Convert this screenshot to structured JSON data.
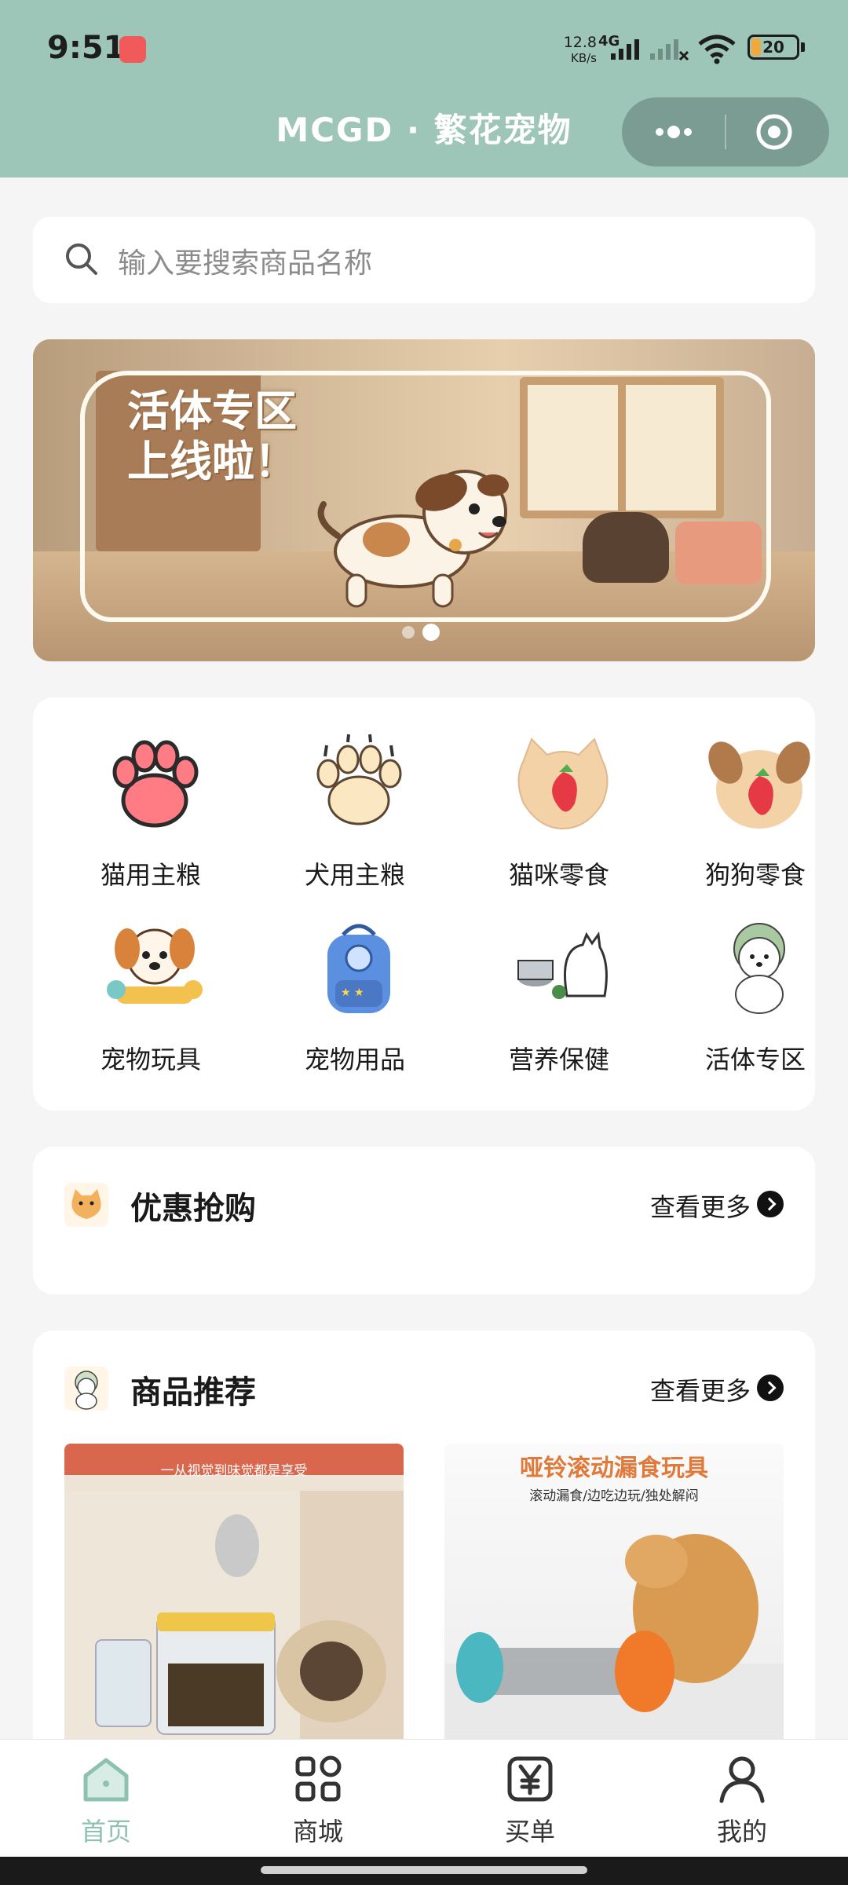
{
  "status_bar": {
    "time": "9:51",
    "network_speed_value": "12.8",
    "network_speed_unit": "KB/s",
    "network_type": "4G",
    "battery_level": "20"
  },
  "header": {
    "title": "MCGD · 繁花宠物"
  },
  "search": {
    "placeholder": "输入要搜索商品名称"
  },
  "banner": {
    "headline_line1": "活体专区",
    "headline_line2": "上线啦！",
    "slide_count": 2,
    "active_slide": 2
  },
  "categories": [
    {
      "label": "猫用主粮",
      "icon": "cat-paw-icon"
    },
    {
      "label": "犬用主粮",
      "icon": "dog-paw-icon"
    },
    {
      "label": "猫咪零食",
      "icon": "cat-cookie-icon"
    },
    {
      "label": "狗狗零食",
      "icon": "dog-cookie-icon"
    },
    {
      "label": "宠物玩具",
      "icon": "puppy-toy-icon"
    },
    {
      "label": "宠物用品",
      "icon": "backpack-icon"
    },
    {
      "label": "营养保健",
      "icon": "cat-bowl-icon"
    },
    {
      "label": "活体专区",
      "icon": "puppy-icon"
    }
  ],
  "deals": {
    "title": "优惠抢购",
    "more": "查看更多"
  },
  "recommend": {
    "title": "商品推荐",
    "more": "查看更多",
    "products": [
      {
        "title": "",
        "subtitle": "一从视觉到味觉都是享受"
      },
      {
        "title": "哑铃滚动漏食玩具",
        "subtitle": "滚动漏食/边吃边玩/独处解闷"
      }
    ]
  },
  "tabbar": {
    "items": [
      {
        "label": "首页",
        "icon": "home-icon"
      },
      {
        "label": "商城",
        "icon": "grid-icon"
      },
      {
        "label": "买单",
        "icon": "yen-icon"
      },
      {
        "label": "我的",
        "icon": "user-icon"
      }
    ],
    "active_index": 0
  },
  "colors": {
    "header_bg": "#9dc5b8",
    "accent": "#8fc1b1",
    "page_bg": "#f5f5f5"
  }
}
